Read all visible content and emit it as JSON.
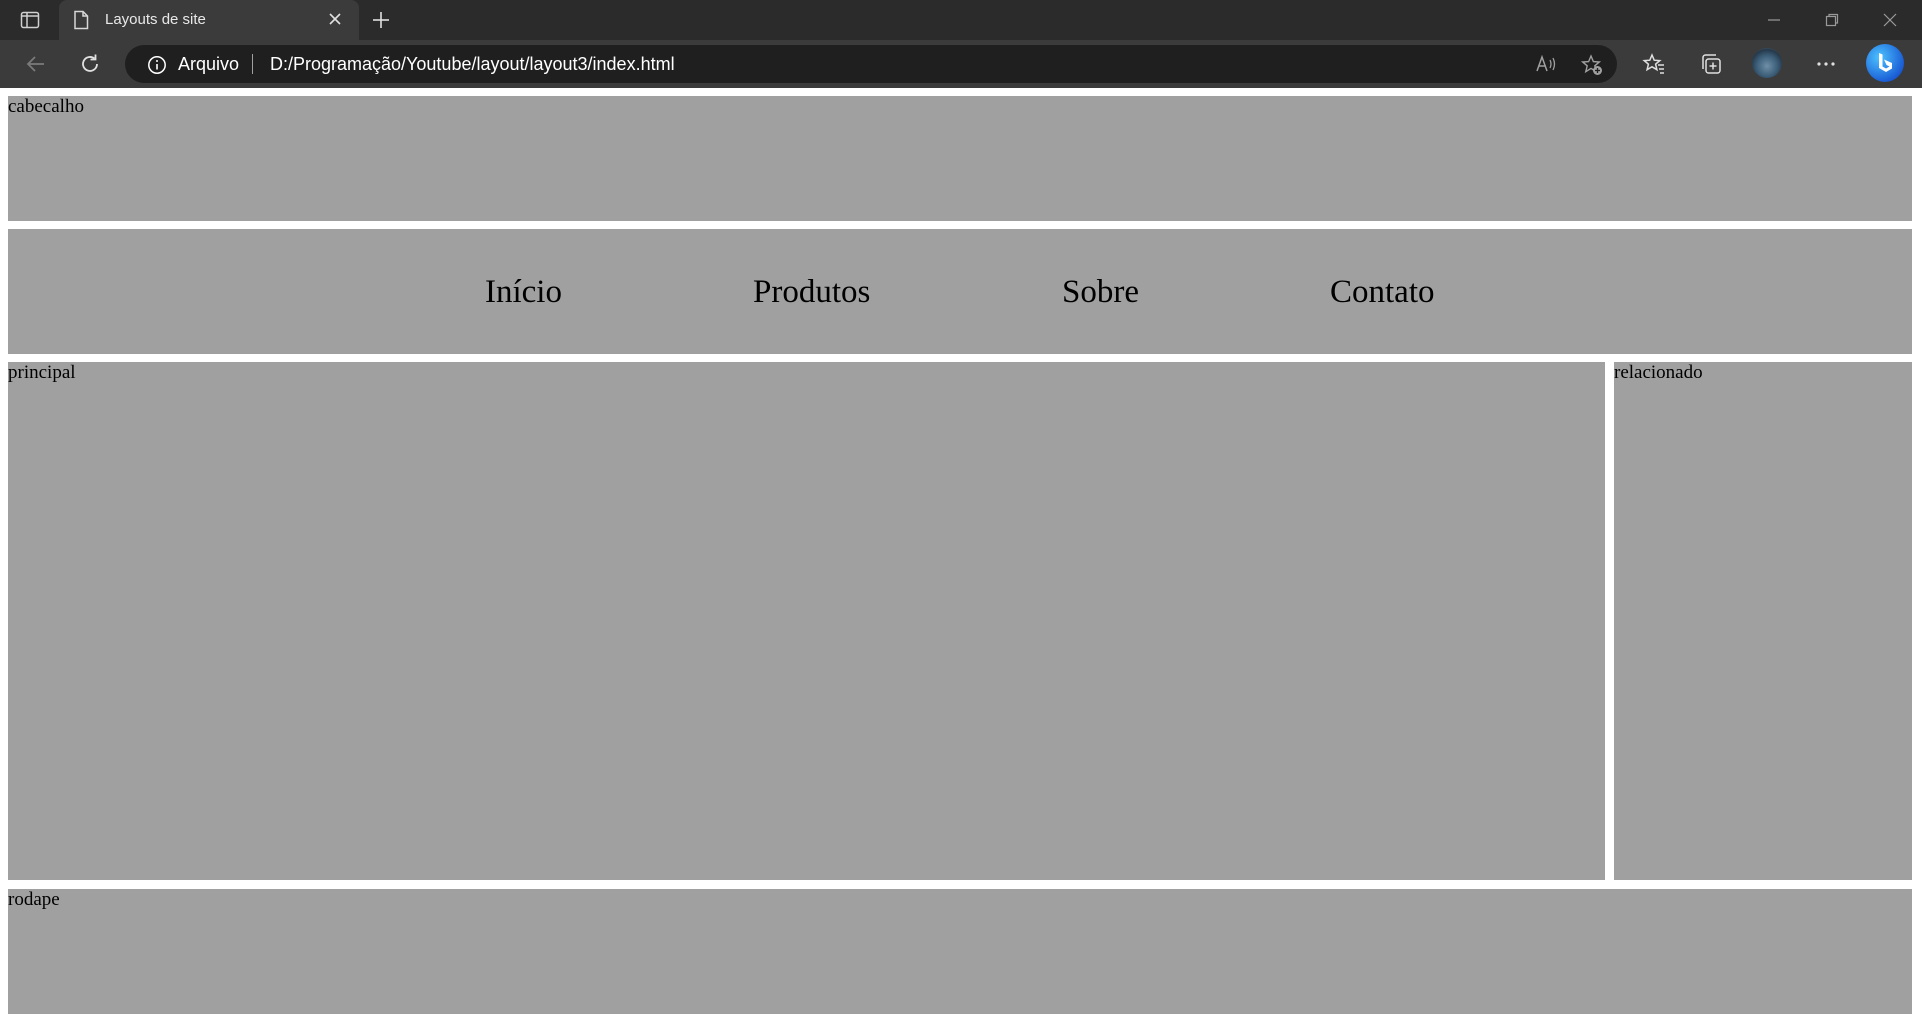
{
  "browser": {
    "tab": {
      "title": "Layouts de site"
    },
    "address_bar": {
      "site_info_label": "Arquivo",
      "url": "D:/Programação/Youtube/layout/layout3/index.html"
    }
  },
  "page": {
    "header": {
      "label": "cabecalho"
    },
    "menu": {
      "items": [
        {
          "label": "Início"
        },
        {
          "label": "Produtos"
        },
        {
          "label": "Sobre"
        },
        {
          "label": "Contato"
        }
      ]
    },
    "main": {
      "label": "principal"
    },
    "aside": {
      "label": "relacionado"
    },
    "footer": {
      "label": "rodape"
    }
  },
  "colors": {
    "chrome_dark": "#2b2b2b",
    "chrome_tab": "#3b3b3b",
    "block_gray": "#a0a0a0"
  }
}
